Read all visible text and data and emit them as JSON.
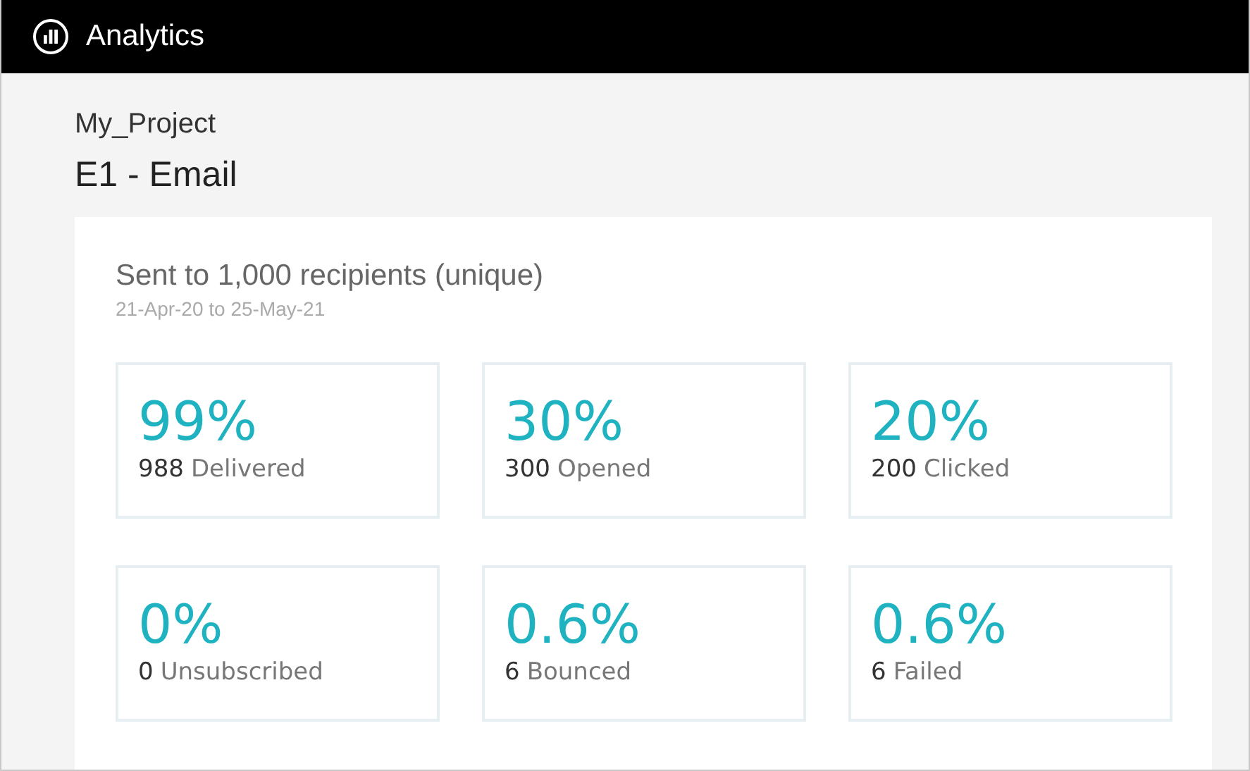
{
  "header": {
    "title": "Analytics"
  },
  "project": "My_Project",
  "title": "E1 - Email",
  "summary": {
    "heading": "Sent to 1,000 recipients (unique)",
    "date_range": "21-Apr-20 to 25-May-21"
  },
  "stats": [
    {
      "percent": "99%",
      "count": "988",
      "label": "Delivered"
    },
    {
      "percent": "30%",
      "count": "300",
      "label": "Opened"
    },
    {
      "percent": "20%",
      "count": "200",
      "label": "Clicked"
    },
    {
      "percent": "0%",
      "count": "0",
      "label": "Unsubscribed"
    },
    {
      "percent": "0.6%",
      "count": "6",
      "label": "Bounced"
    },
    {
      "percent": "0.6%",
      "count": "6",
      "label": "Failed"
    }
  ]
}
